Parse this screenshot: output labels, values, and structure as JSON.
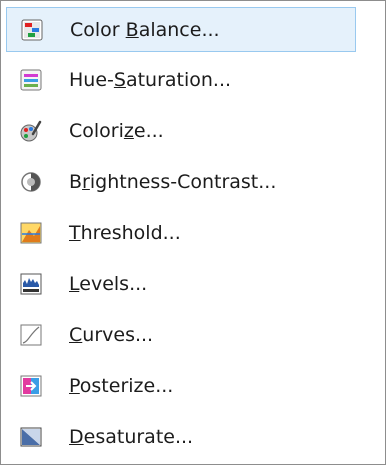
{
  "menu": {
    "items": [
      {
        "id": "color-balance",
        "pre": "Color ",
        "key": "B",
        "post": "alance...",
        "icon": "color-balance-icon",
        "selected": true
      },
      {
        "id": "hue-saturation",
        "pre": "Hue-",
        "key": "S",
        "post": "aturation...",
        "icon": "hue-saturation-icon",
        "selected": false
      },
      {
        "id": "colorize",
        "pre": "Colori",
        "key": "z",
        "post": "e...",
        "icon": "colorize-icon",
        "selected": false
      },
      {
        "id": "brightness-contrast",
        "pre": "B",
        "key": "r",
        "post": "ightness-Contrast...",
        "icon": "brightness-contrast-icon",
        "selected": false
      },
      {
        "id": "threshold",
        "pre": "",
        "key": "T",
        "post": "hreshold...",
        "icon": "threshold-icon",
        "selected": false
      },
      {
        "id": "levels",
        "pre": "",
        "key": "L",
        "post": "evels...",
        "icon": "levels-icon",
        "selected": false
      },
      {
        "id": "curves",
        "pre": "",
        "key": "C",
        "post": "urves...",
        "icon": "curves-icon",
        "selected": false
      },
      {
        "id": "posterize",
        "pre": "",
        "key": "P",
        "post": "osterize...",
        "icon": "posterize-icon",
        "selected": false
      },
      {
        "id": "desaturate",
        "pre": "",
        "key": "D",
        "post": "esaturate...",
        "icon": "desaturate-icon",
        "selected": false
      }
    ]
  },
  "colors": {
    "selection_bg": "#e5f1fb",
    "selection_border": "#99c9ef",
    "text": "#1c1c1c"
  }
}
